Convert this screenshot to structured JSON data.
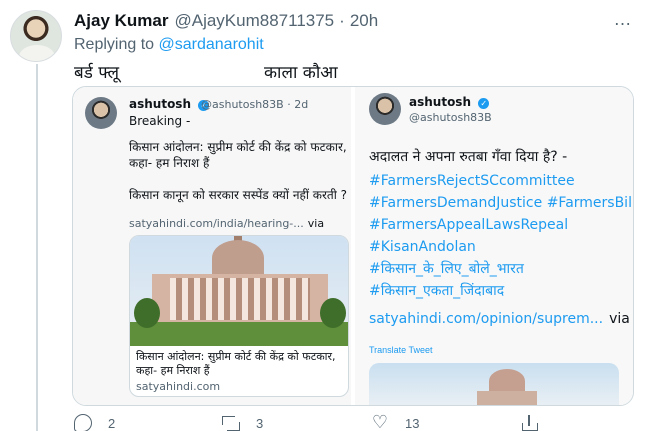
{
  "reply_tweet": {
    "author": {
      "name": "Ajay Kumar",
      "handle": "@AjayKum88711375",
      "time": "20h",
      "avatar_icon": "profile-photo"
    },
    "separator": "·",
    "replying_to": {
      "prefix": "Replying to",
      "mention": "@sardanarohit"
    },
    "text": {
      "left": "बर्ड फ्लू",
      "right": "काला कौआ"
    },
    "more_icon": "…"
  },
  "quoted_images": {
    "left_screenshot": {
      "author_name": "ashutosh",
      "author_handle": "@ashutosh83B · 2d",
      "breaking": "Breaking -",
      "line1": "किसान आंदोलन: सुप्रीम कोर्ट की केंद्र को फटकार,",
      "line2": "कहा- हम निराश हैं",
      "line3": "किसान कानून को सरकार सस्पेंड क्यों नहीं करती ?",
      "link": "satyahindi.com/india/hearing-...",
      "link_via": "via",
      "card_title": "किसान आंदोलन: सुप्रीम कोर्ट की केंद्र को फटकार, कहा- हम निराश हैं",
      "card_domain": "satyahindi.com"
    },
    "right_screenshot": {
      "author_name": "ashutosh",
      "author_handle": "@ashutosh83B",
      "text": "अदालत ने अपना रुतबा गँवा दिया है? -",
      "hashtags": [
        "#FarmersRejectSCcommittee",
        "#FarmersDemandJustice #FarmersBill",
        "#FarmersAppealLawsRepeal",
        "#KisanAndolan",
        "#किसान_के_लिए_बोले_भारत",
        "#किसान_एकता_जिंदाबाद"
      ],
      "link": "satyahindi.com/opinion/suprem...",
      "link_via": "via",
      "translate": "Translate Tweet"
    }
  },
  "actions": {
    "reply_count": "2",
    "retweet_count": "3",
    "like_count": "13"
  },
  "colors": {
    "accent": "#1d9bf0",
    "secondary_text": "#536471",
    "border": "#cfd9de"
  }
}
